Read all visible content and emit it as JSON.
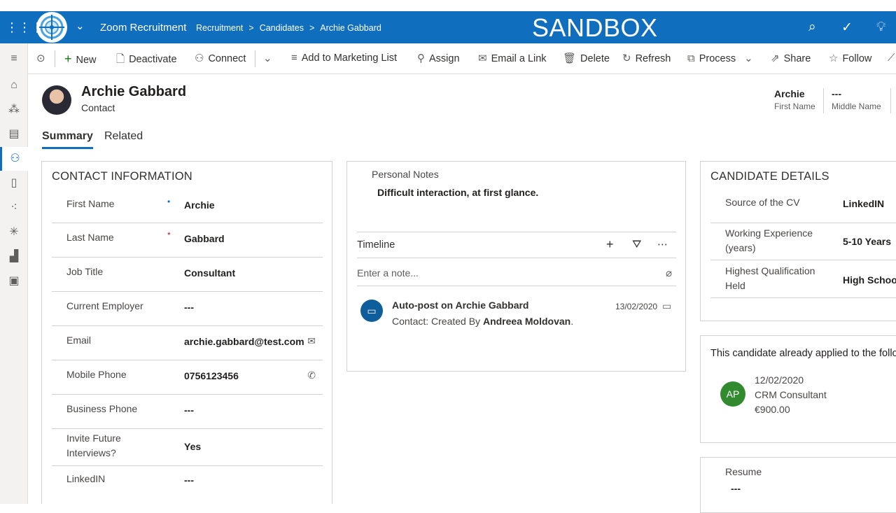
{
  "topbar": {
    "app_name": "Zoom Recruitment",
    "breadcrumb": [
      "Recruitment",
      "Candidates",
      "Archie Gabbard"
    ],
    "breadcrumb_sep": ">",
    "environment_label": "SANDBOX",
    "bg_color": "#106ebe"
  },
  "commands": {
    "new": "New",
    "deactivate": "Deactivate",
    "connect": "Connect",
    "add_to_marketing_list": "Add to Marketing List",
    "assign": "Assign",
    "email_a_link": "Email a Link",
    "delete": "Delete",
    "refresh": "Refresh",
    "process": "Process",
    "share": "Share",
    "follow": "Follow"
  },
  "record": {
    "name": "Archie Gabbard",
    "type": "Contact",
    "header_fields": [
      {
        "value": "Archie",
        "label": "First Name"
      },
      {
        "value": "---",
        "label": "Middle Name"
      }
    ]
  },
  "tabs": [
    "Summary",
    "Related"
  ],
  "contact_information": {
    "title": "CONTACT INFORMATION",
    "fields": [
      {
        "label": "First Name",
        "value": "Archie",
        "required": "•"
      },
      {
        "label": "Last Name",
        "value": "Gabbard",
        "required": "*"
      },
      {
        "label": "Job Title",
        "value": "Consultant"
      },
      {
        "label": "Current Employer",
        "value": "---"
      },
      {
        "label": "Email",
        "value": "archie.gabbard@test.com"
      },
      {
        "label": "Mobile Phone",
        "value": "0756123456"
      },
      {
        "label": "Business Phone",
        "value": "---"
      },
      {
        "label": "Invite Future Interviews?",
        "value": "Yes"
      },
      {
        "label": "LinkedIN",
        "value": "---"
      }
    ]
  },
  "notes": {
    "label": "Personal Notes",
    "value": "Difficult interaction, at first glance."
  },
  "timeline": {
    "title": "Timeline",
    "note_placeholder": "Enter a note...",
    "post": {
      "title": "Auto-post on Archie Gabbard",
      "subtitle_prefix": "Contact: Created By",
      "author": "Andreea Moldovan",
      "subtitle_suffix": ".",
      "date": "13/02/2020"
    }
  },
  "candidate_details": {
    "title": "CANDIDATE DETAILS",
    "fields": [
      {
        "label": "Source of the CV",
        "value": "LinkedIN"
      },
      {
        "label": "Working Experience (years)",
        "value": "5-10 Years"
      },
      {
        "label": "Highest Qualification Held",
        "value": "High School"
      }
    ]
  },
  "applications": {
    "title": "This candidate already applied to the follo",
    "item": {
      "initials": "AP",
      "date": "12/02/2020",
      "position": "CRM Consultant",
      "amount": "€900.00",
      "badge_color": "#328a2e"
    }
  },
  "resume": {
    "label": "Resume",
    "value": "---"
  }
}
